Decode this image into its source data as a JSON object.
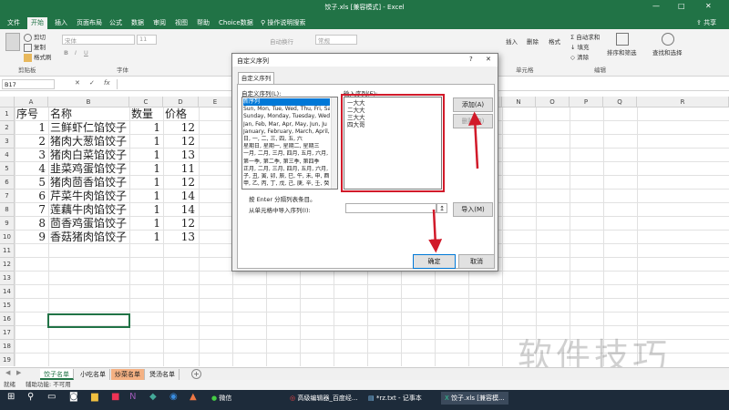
{
  "titlebar": {
    "title": "饺子.xls [兼容模式] - Excel",
    "minimize": "—",
    "maximize": "□",
    "close": "✕"
  },
  "tabs": [
    "文件",
    "开始",
    "插入",
    "页面布局",
    "公式",
    "数据",
    "审阅",
    "视图",
    "帮助",
    "Choice数据",
    "操作说明搜索"
  ],
  "share": "共享",
  "ribbon": {
    "cut": "剪切",
    "copy": "复制",
    "format_painter": "格式刷",
    "clipboard": "剪贴板",
    "font": "字体",
    "font_name": "宋体",
    "font_size": "11",
    "wrap": "自动换行",
    "number_format": "常规",
    "cells": "单元格",
    "insert": "插入",
    "delete": "删除",
    "format": "格式",
    "autosum": "自动求和",
    "fill": "填充",
    "clear": "清除",
    "sort_filter": "排序和筛选",
    "find_select": "查找和选择",
    "editing": "编辑"
  },
  "formula_bar": {
    "name_box": "B17",
    "fx": "fx",
    "value": ""
  },
  "columns": [
    "A",
    "B",
    "C",
    "D",
    "E",
    "F",
    "G",
    "H",
    "I",
    "J",
    "K",
    "L",
    "M",
    "N",
    "O",
    "P",
    "Q",
    "R"
  ],
  "rows": [
    "1",
    "2",
    "3",
    "4",
    "5",
    "6",
    "7",
    "8",
    "9",
    "10",
    "11",
    "12",
    "13",
    "14",
    "15",
    "16",
    "17",
    "18",
    "19",
    "20"
  ],
  "table": {
    "header": [
      "序号",
      "名称",
      "数量",
      "价格"
    ],
    "rows": [
      [
        "1",
        "三鲜虾仁馅饺子",
        "1",
        "12"
      ],
      [
        "2",
        "猪肉大葱馅饺子",
        "1",
        "12"
      ],
      [
        "3",
        "猪肉白菜馅饺子",
        "1",
        "13"
      ],
      [
        "4",
        "韭菜鸡蛋馅饺子",
        "1",
        "11"
      ],
      [
        "5",
        "猪肉茴香馅饺子",
        "1",
        "12"
      ],
      [
        "6",
        "芹菜牛肉馅饺子",
        "1",
        "14"
      ],
      [
        "7",
        "莲藕牛肉馅饺子",
        "1",
        "14"
      ],
      [
        "8",
        "茴香鸡蛋馅饺子",
        "1",
        "12"
      ],
      [
        "9",
        "香菇猪肉馅饺子",
        "1",
        "13"
      ]
    ]
  },
  "dialog": {
    "title": "自定义序列",
    "help": "?",
    "close": "✕",
    "tab": "自定义序列",
    "list_label": "自定义序列(L):",
    "entries_label": "输入序列(E):",
    "lists": [
      "新序列",
      "Sun, Mon, Tue, Wed, Thu, Fri, Sa",
      "Sunday, Monday, Tuesday, Wed",
      "Jan, Feb, Mar, Apr, May, Jun, Ju",
      "January, February, March, April,",
      "日, 一, 二, 三, 四, 五, 六",
      "星期日, 星期一, 星期二, 星期三",
      "一月, 二月, 三月, 四月, 五月, 六月, 七",
      "第一季, 第二季, 第三季, 第四季",
      "正月, 二月, 三月, 四月, 五月, 六月, 七",
      "子, 丑, 寅, 卯, 辰, 巳, 午, 未, 申, 酉",
      "甲, 乙, 丙, 丁, 戊, 己, 庚, 辛, 壬, 癸"
    ],
    "entries": [
      "一大大",
      "二大大",
      "三大大",
      "四大哥"
    ],
    "add": "添加(A)",
    "delete": "删除(D)",
    "hint": "按 Enter 分隔列表条目。",
    "import_label": "从单元格中导入序列(I):",
    "import_btn": "导入(M)",
    "ok": "确定",
    "cancel": "取消"
  },
  "sheets": [
    "饺子名单",
    "小吃名单",
    "炒菜名单",
    "煲汤名单"
  ],
  "add_sheet": "+",
  "status": {
    "ready": "就绪",
    "accessibility": "辅助功能: 不可用"
  },
  "taskbar": {
    "wechat": "微信",
    "chrome": "高级编辑器_百度经...",
    "notepad": "*rz.txt - 记事本",
    "excel": "饺子.xls [兼容模..."
  },
  "watermark": "软件技巧",
  "colors": {
    "excel_green": "#217346",
    "annotation_red": "#d11a2a",
    "selection_blue": "#0078d7",
    "sheet_orange": "#f4b183"
  }
}
